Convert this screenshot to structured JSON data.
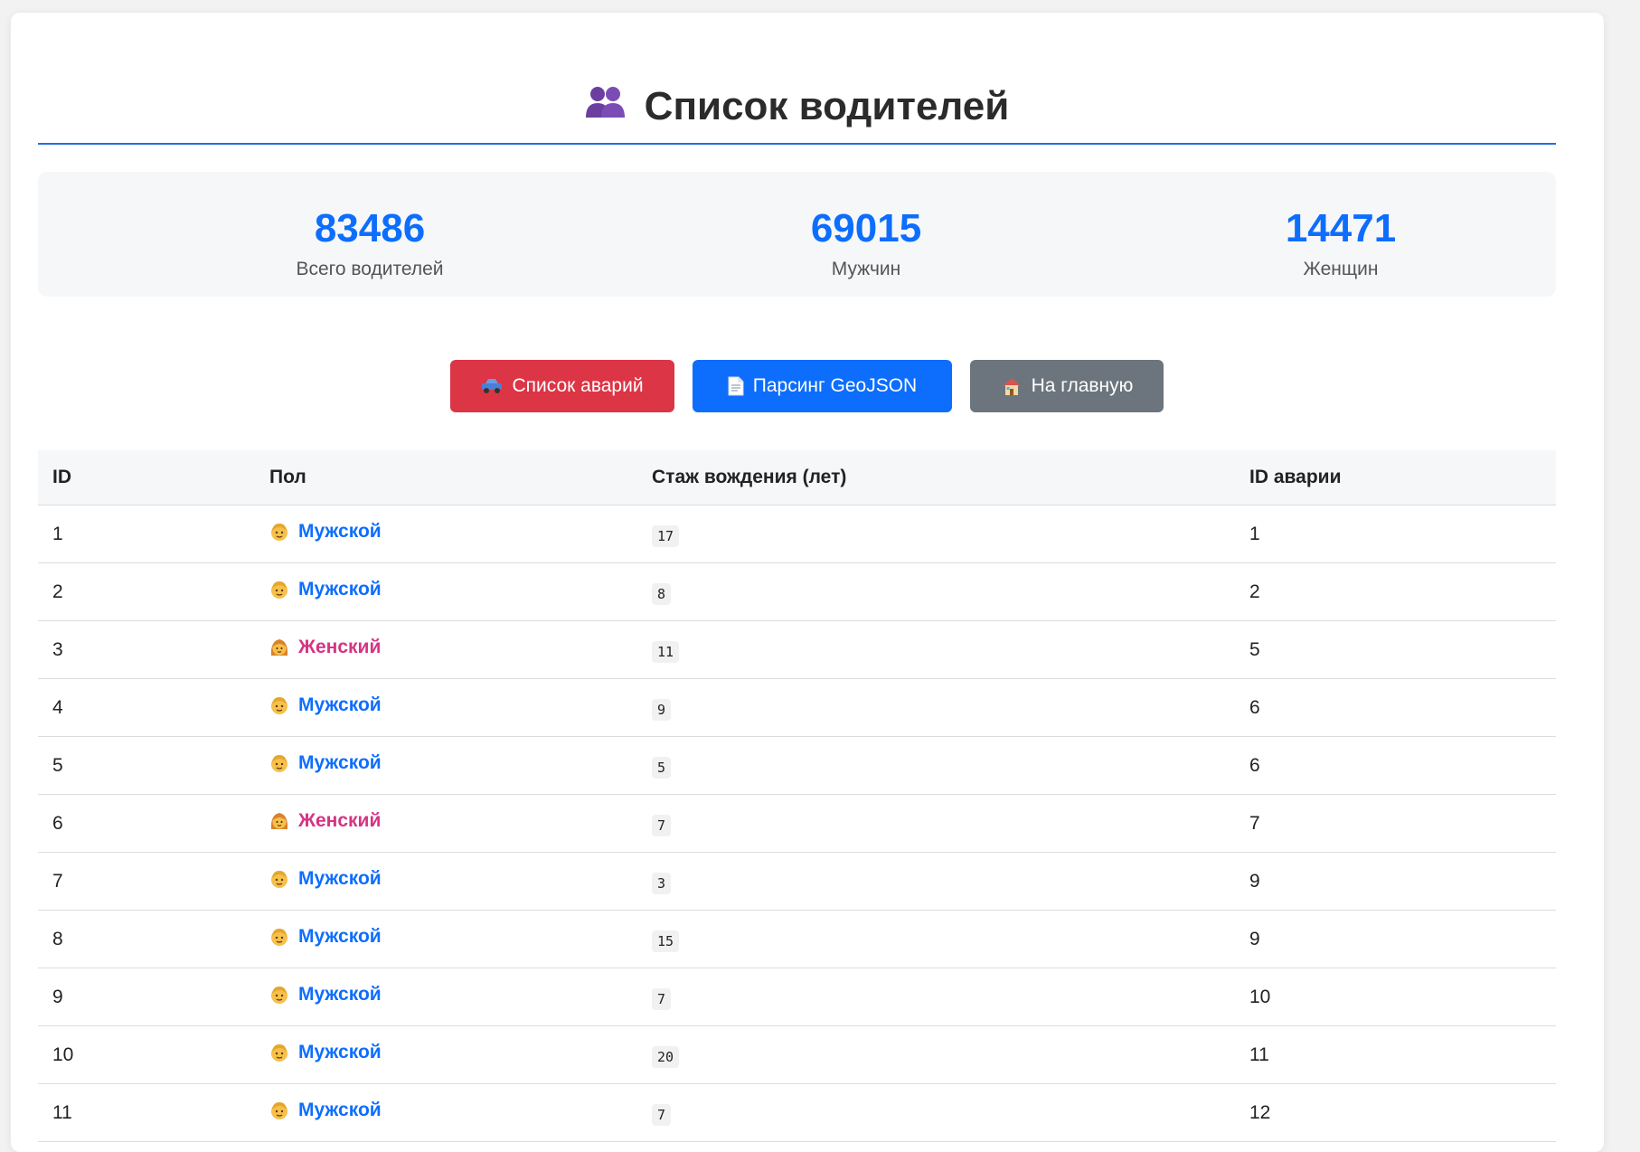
{
  "header": {
    "title": "Список водителей",
    "icon": "people-icon"
  },
  "stats": [
    {
      "value": "83486",
      "label": "Всего водителей"
    },
    {
      "value": "69015",
      "label": "Мужчин"
    },
    {
      "value": "14471",
      "label": "Женщин"
    }
  ],
  "actions": [
    {
      "label": "Список аварий",
      "icon": "car-icon",
      "color": "#dc3545"
    },
    {
      "label": "Парсинг GeoJSON",
      "icon": "document-icon",
      "color": "#0d6efd"
    },
    {
      "label": "На главную",
      "icon": "house-icon",
      "color": "#6c757d"
    }
  ],
  "table": {
    "columns": [
      "ID",
      "Пол",
      "Стаж вождения (лет)",
      "ID аварии"
    ],
    "rows": [
      {
        "id": "1",
        "gender": "Мужской",
        "experience": "17",
        "accident_id": "1"
      },
      {
        "id": "2",
        "gender": "Мужской",
        "experience": "8",
        "accident_id": "2"
      },
      {
        "id": "3",
        "gender": "Женский",
        "experience": "11",
        "accident_id": "5"
      },
      {
        "id": "4",
        "gender": "Мужской",
        "experience": "9",
        "accident_id": "6"
      },
      {
        "id": "5",
        "gender": "Мужской",
        "experience": "5",
        "accident_id": "6"
      },
      {
        "id": "6",
        "gender": "Женский",
        "experience": "7",
        "accident_id": "7"
      },
      {
        "id": "7",
        "gender": "Мужской",
        "experience": "3",
        "accident_id": "9"
      },
      {
        "id": "8",
        "gender": "Мужской",
        "experience": "15",
        "accident_id": "9"
      },
      {
        "id": "9",
        "gender": "Мужской",
        "experience": "7",
        "accident_id": "10"
      },
      {
        "id": "10",
        "gender": "Мужской",
        "experience": "20",
        "accident_id": "11"
      },
      {
        "id": "11",
        "gender": "Мужской",
        "experience": "7",
        "accident_id": "12"
      }
    ]
  },
  "colors": {
    "accent": "#0d6efd",
    "male": "#0d6efd",
    "female": "#d63384",
    "divider": "#1e6fe0"
  }
}
